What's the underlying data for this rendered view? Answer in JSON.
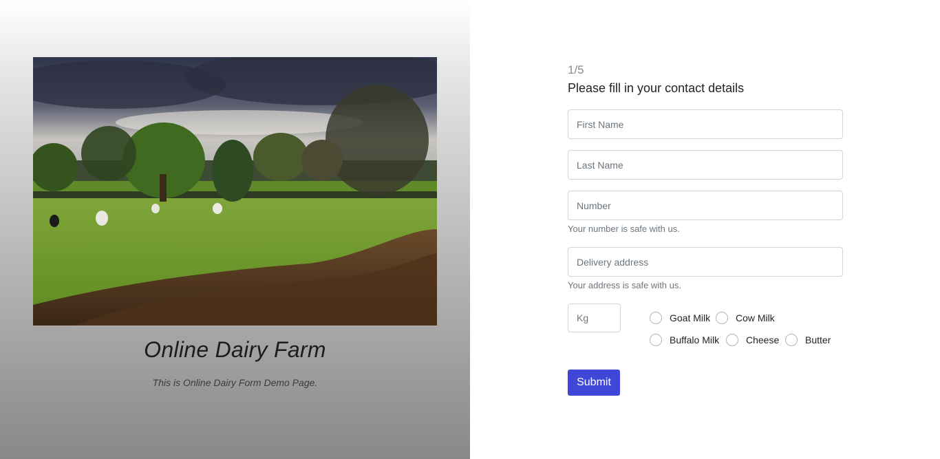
{
  "hero": {
    "title": "Online Dairy Farm",
    "subtitle": "This is Online Dairy Form Demo Page."
  },
  "form": {
    "step": "1/5",
    "heading": "Please fill in your contact details",
    "first_name_placeholder": "First Name",
    "last_name_placeholder": "Last Name",
    "number_placeholder": "Number",
    "number_help": "Your number is safe with us.",
    "address_placeholder": "Delivery address",
    "address_help": "Your address is safe with us.",
    "kg_placeholder": "Kg",
    "products": [
      {
        "label": "Goat Milk"
      },
      {
        "label": "Cow Milk"
      },
      {
        "label": "Buffalo Milk"
      },
      {
        "label": "Cheese"
      },
      {
        "label": "Butter"
      }
    ],
    "submit_label": "Submit"
  },
  "colors": {
    "accent": "#3f47d9",
    "input_border": "#ced4da",
    "help_text": "#6c757d"
  }
}
